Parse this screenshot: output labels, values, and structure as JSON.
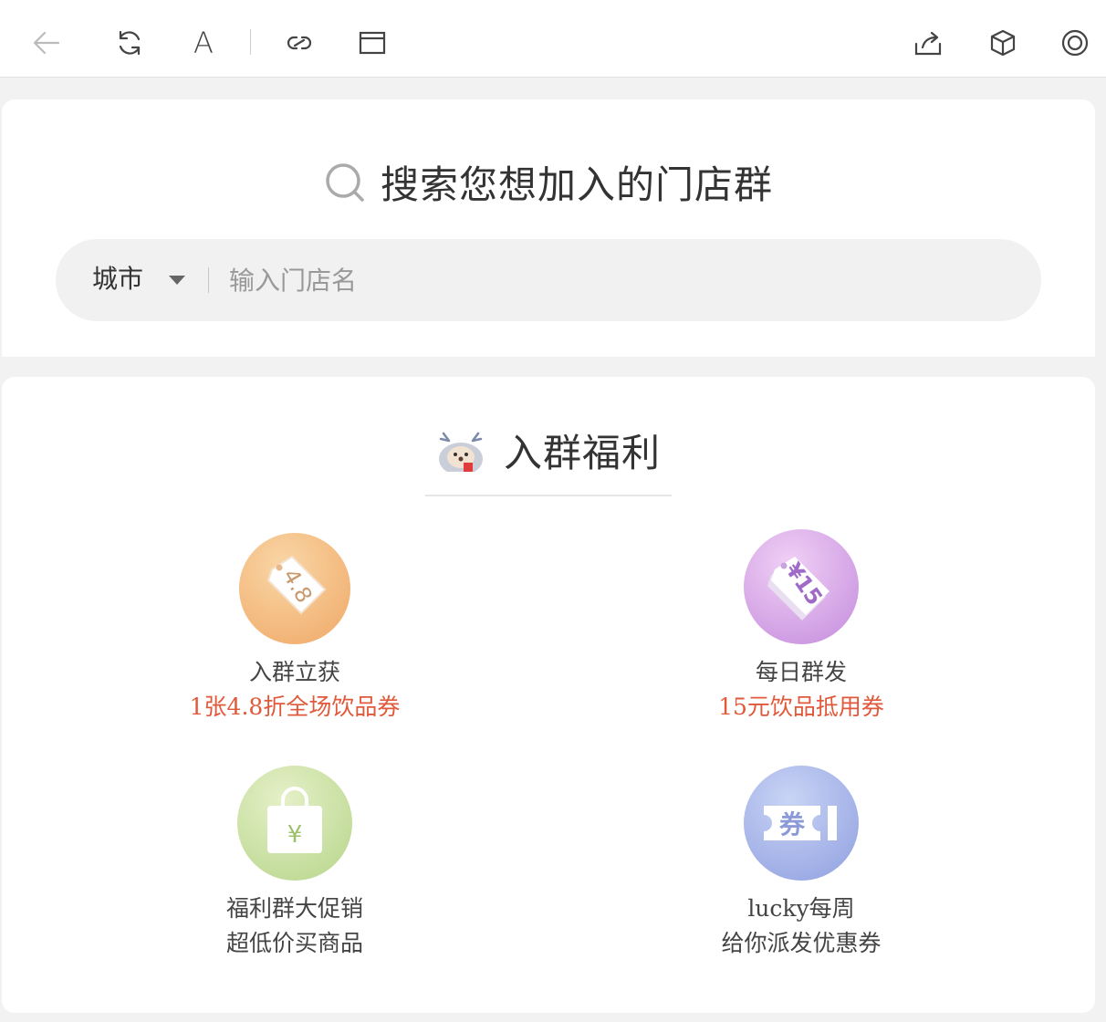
{
  "toolbar": {
    "font_label": "A"
  },
  "search": {
    "title": "搜索您想加入的门店群",
    "city_label": "城市",
    "input_placeholder": "输入门店名",
    "input_value": ""
  },
  "benefits": {
    "title": "入群福利",
    "items": [
      {
        "icon": "price-tag-icon",
        "badge": "4.8",
        "line1": "入群立获",
        "line2": "1张4.8折全场饮品券",
        "line2_color": "#e0593a"
      },
      {
        "icon": "coupon-tag-icon",
        "badge": "¥15",
        "line1": "每日群发",
        "line2": "15元饮品抵用券",
        "line2_color": "#e0593a"
      },
      {
        "icon": "shopping-bag-icon",
        "badge": "¥",
        "line1": "福利群大促销",
        "line2": "超低价买商品",
        "line2_color": "#444444"
      },
      {
        "icon": "ticket-icon",
        "badge": "券",
        "line1": "lucky每周",
        "line2": "给你派发优惠券",
        "line2_color": "#444444"
      }
    ]
  }
}
